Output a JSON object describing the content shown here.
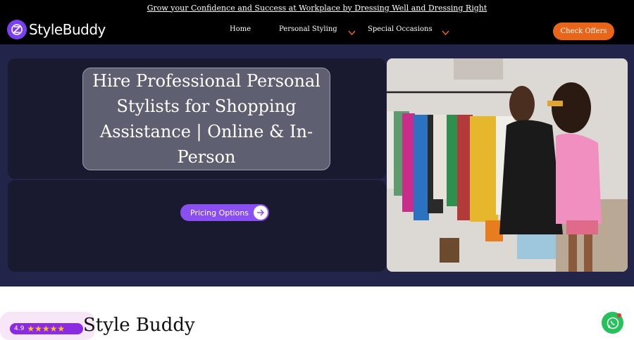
{
  "announcement": {
    "text": "Grow your Confidence and Success at Workplace by Dressing Well and Dressing Right"
  },
  "header": {
    "logo_text": "StyleBuddy",
    "nav": [
      {
        "label": "Home",
        "has_dropdown": false
      },
      {
        "label": "Personal Styling",
        "has_dropdown": true
      },
      {
        "label": "Special Occasions",
        "has_dropdown": true
      }
    ],
    "cta_label": "Check Offers"
  },
  "hero": {
    "title": "Hire Professional Personal Stylists for Shopping Assistance | Online & In-Person",
    "button_label": "Pricing Options",
    "image_alt": "stylist-helping-client-with-clothing-rack"
  },
  "section": {
    "title_visible": "Style Buddy",
    "rating_value": "4.9",
    "rating_stars": "★★★★★"
  },
  "colors": {
    "accent_orange": "#e8651a",
    "brand_purple": "#8a4ff0",
    "hero_bg": "#232449",
    "panel_bg": "#191a30",
    "whatsapp_green": "#25c15a"
  },
  "icons": [
    "stylebuddy-logo-icon",
    "chevron-down-icon",
    "arrow-right-icon",
    "whatsapp-icon"
  ]
}
